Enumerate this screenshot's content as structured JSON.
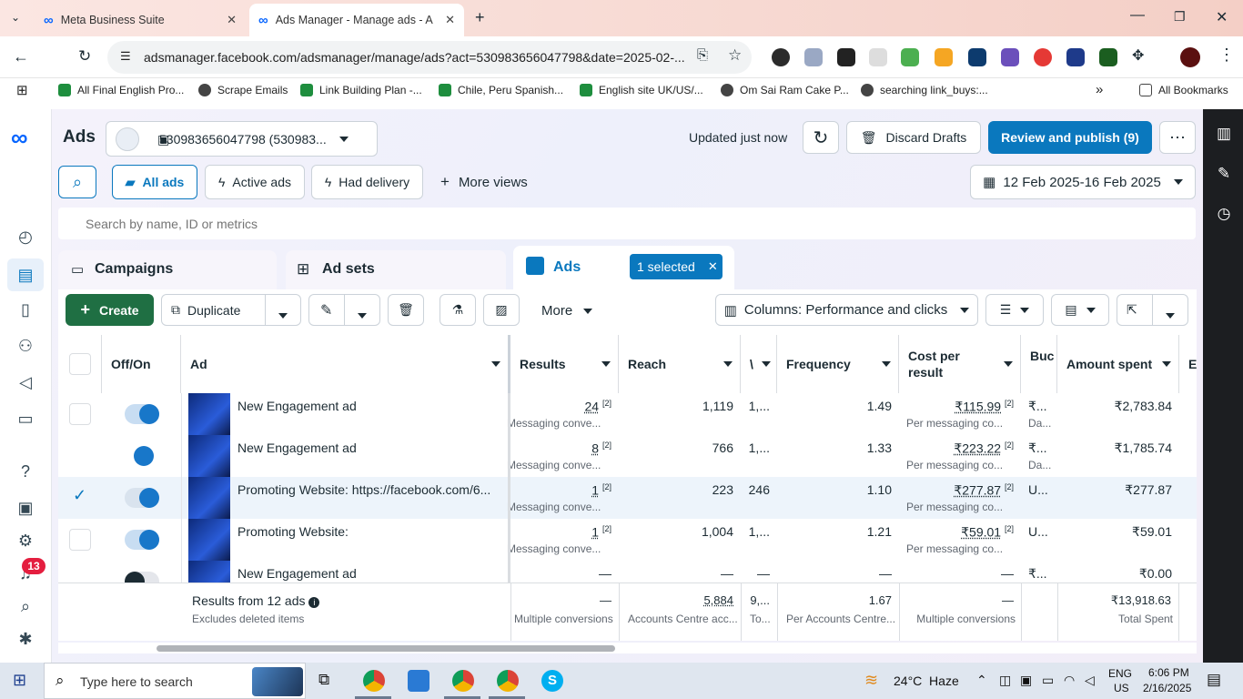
{
  "browser": {
    "tabs": [
      {
        "title": "Meta Business Suite"
      },
      {
        "title": "Ads Manager - Manage ads - A"
      }
    ],
    "url": "adsmanager.facebook.com/adsmanager/manage/ads?act=530983656047798&date=2025-02-...",
    "bookmarks": [
      "All Final English Pro...",
      "Scrape Emails",
      "Link Building Plan -...",
      "Chile, Peru Spanish...",
      "English site UK/US/...",
      "Om Sai Ram Cake P...",
      "searching link_buys:..."
    ],
    "all_bookmarks": "All Bookmarks"
  },
  "header": {
    "title": "Ads",
    "account": "530983656047798 (530983...",
    "updated": "Updated just now",
    "discard": "Discard Drafts",
    "publish": "Review and publish (9)"
  },
  "views": {
    "all_ads": "All ads",
    "active_ads": "Active ads",
    "had_delivery": "Had delivery",
    "more_views": "More views",
    "date_range": "12 Feb 2025-16 Feb 2025"
  },
  "search": {
    "placeholder": "Search by name, ID or metrics"
  },
  "level_tabs": {
    "campaigns": "Campaigns",
    "ad_sets": "Ad sets",
    "ads": "Ads",
    "selected": "1 selected"
  },
  "toolbar": {
    "create": "Create",
    "duplicate": "Duplicate",
    "more": "More",
    "columns": "Columns: Performance and clicks"
  },
  "table": {
    "headers": {
      "offon": "Off/On",
      "ad": "Ad",
      "results": "Results",
      "reach": "Reach",
      "v": "\\",
      "frequency": "Frequency",
      "cpr1": "Cost per",
      "cpr2": "result",
      "budget": "Buc",
      "amount": "Amount spent",
      "e": "E"
    },
    "rows": [
      {
        "name": "New Engagement ad",
        "results": "24",
        "results_sup": "[2]",
        "results_sub": "Messaging conve...",
        "reach": "1,119",
        "v": "1,...",
        "frequency": "1.49",
        "cpr": "₹115.99",
        "cpr_sup": "[2]",
        "cpr_sub": "Per messaging co...",
        "budget": "₹...",
        "budget_sub": "Da...",
        "amount": "₹2,783.84"
      },
      {
        "name": "New Engagement ad",
        "results": "8",
        "results_sup": "[2]",
        "results_sub": "Messaging conve...",
        "reach": "766",
        "v": "1,...",
        "frequency": "1.33",
        "cpr": "₹223.22",
        "cpr_sup": "[2]",
        "cpr_sub": "Per messaging co...",
        "budget": "₹...",
        "budget_sub": "Da...",
        "amount": "₹1,785.74"
      },
      {
        "name": "Promoting Website: https://facebook.com/6...",
        "results": "1",
        "results_sup": "[2]",
        "results_sub": "Messaging conve...",
        "reach": "223",
        "v": "246",
        "frequency": "1.10",
        "cpr": "₹277.87",
        "cpr_sup": "[2]",
        "cpr_sub": "Per messaging co...",
        "budget": "U...",
        "budget_sub": "",
        "amount": "₹277.87"
      },
      {
        "name": "Promoting Website:",
        "results": "1",
        "results_sup": "[2]",
        "results_sub": "Messaging conve...",
        "reach": "1,004",
        "v": "1,...",
        "frequency": "1.21",
        "cpr": "₹59.01",
        "cpr_sup": "[2]",
        "cpr_sub": "Per messaging co...",
        "budget": "U...",
        "budget_sub": "",
        "amount": "₹59.01"
      },
      {
        "name": "New Engagement ad",
        "results": "—",
        "results_sup": "",
        "results_sub": "",
        "reach": "—",
        "v": "—",
        "frequency": "—",
        "cpr": "—",
        "cpr_sup": "",
        "cpr_sub": "",
        "budget": "₹...",
        "budget_sub": "",
        "amount": "₹0.00"
      }
    ],
    "totals": {
      "label": "Results from 12 ads",
      "sublabel": "Excludes deleted items",
      "results": "—",
      "results_sub": "Multiple conversions",
      "reach": "5,884",
      "reach_sub": "Accounts Centre acc...",
      "v": "9,...",
      "v_sub": "To...",
      "frequency": "1.67",
      "frequency_sub": "Per Accounts Centre...",
      "cpr": "—",
      "cpr_sub": "Multiple conversions",
      "amount": "₹13,918.63",
      "amount_sub": "Total Spent"
    }
  },
  "leftnav": {
    "badge": "13"
  },
  "taskbar": {
    "search": "Type here to search",
    "weather": "24°C  Haze",
    "lang1": "ENG",
    "lang2": "US",
    "time": "6:06 PM",
    "date": "2/16/2025"
  }
}
